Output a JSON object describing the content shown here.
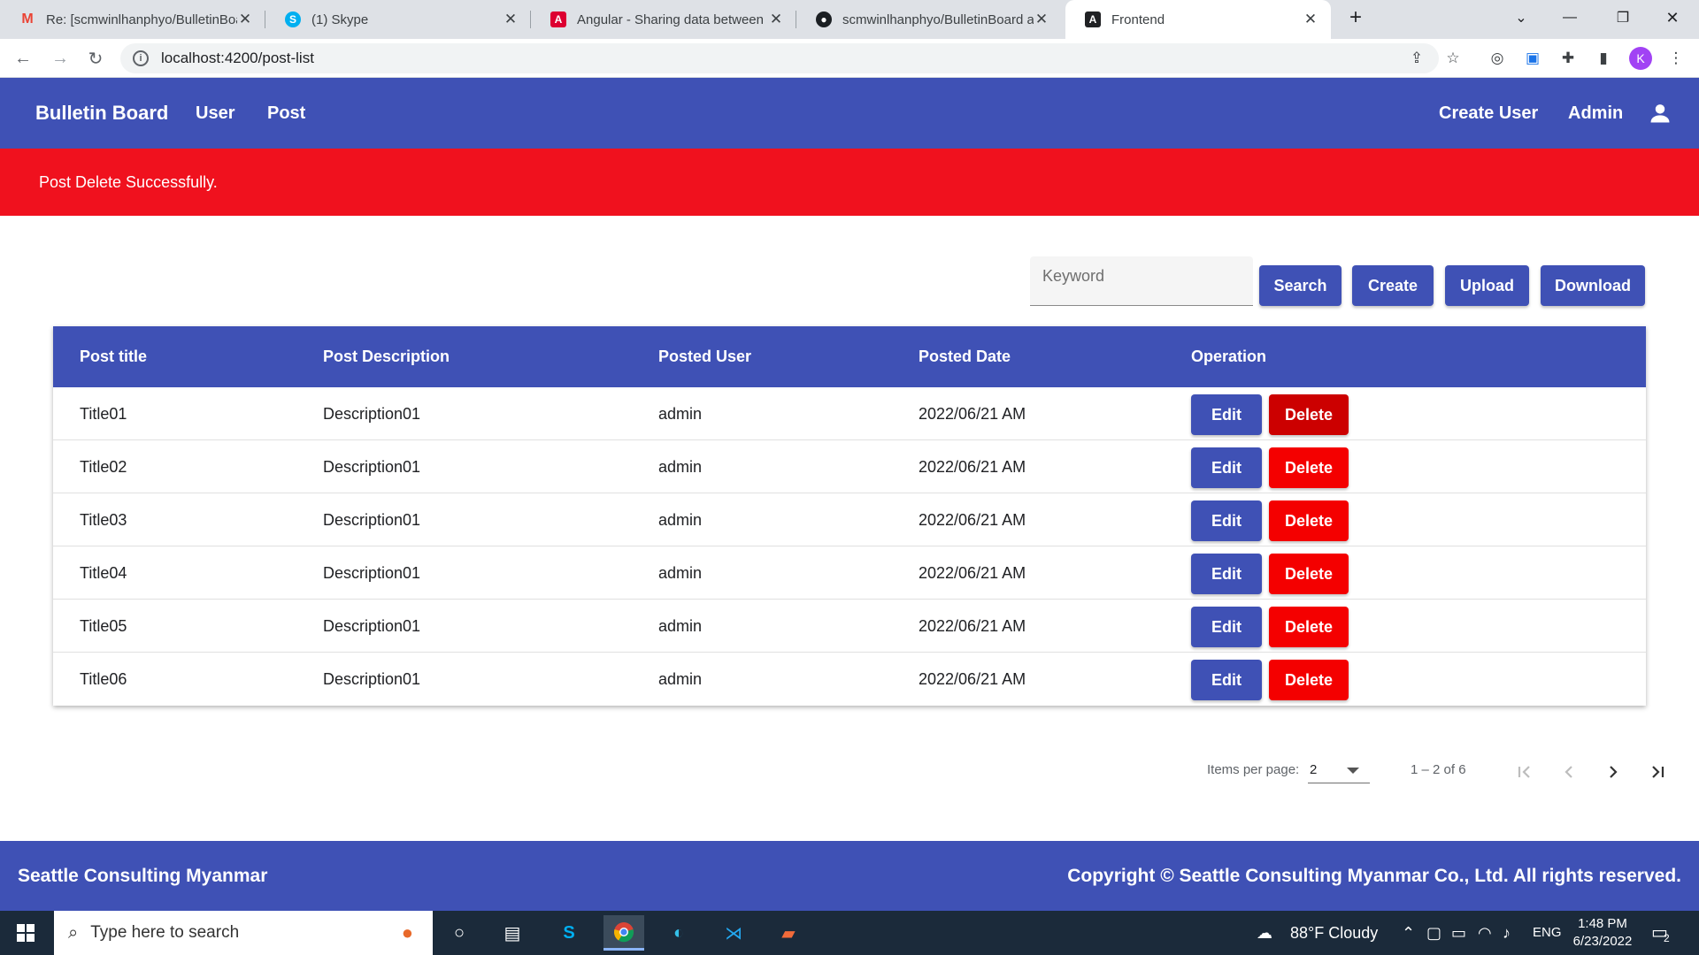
{
  "browser": {
    "tabs": [
      {
        "title": "Re: [scmwinlhanphyo/BulletinBoa",
        "icon": "gmail-icon",
        "color": "#ea4335"
      },
      {
        "title": "(1) Skype",
        "icon": "skype-icon",
        "color": "#00aff0"
      },
      {
        "title": "Angular - Sharing data between",
        "icon": "angular-icon",
        "color": "#dd0031"
      },
      {
        "title": "scmwinlhanphyo/BulletinBoard a",
        "icon": "github-icon",
        "color": "#1b1f23"
      },
      {
        "title": "Frontend",
        "icon": "angular-icon",
        "color": "#202124"
      }
    ],
    "new_tab": "+",
    "url": "localhost:4200/post-list",
    "profile_initial": "K"
  },
  "header": {
    "brand": "Bulletin Board",
    "nav": [
      "User",
      "Post"
    ],
    "create_user": "Create User",
    "admin": "Admin"
  },
  "alert": {
    "message": "Post Delete Successfully."
  },
  "toolbar": {
    "keyword_placeholder": "Keyword",
    "search": "Search",
    "create": "Create",
    "upload": "Upload",
    "download": "Download"
  },
  "table": {
    "columns": [
      "Post title",
      "Post Description",
      "Posted User",
      "Posted Date",
      "Operation"
    ],
    "rows": [
      {
        "title": "Title01",
        "description": "Description01",
        "user": "admin",
        "date": "2022/06/21 AM"
      },
      {
        "title": "Title02",
        "description": "Description01",
        "user": "admin",
        "date": "2022/06/21 AM"
      },
      {
        "title": "Title03",
        "description": "Description01",
        "user": "admin",
        "date": "2022/06/21 AM"
      },
      {
        "title": "Title04",
        "description": "Description01",
        "user": "admin",
        "date": "2022/06/21 AM"
      },
      {
        "title": "Title05",
        "description": "Description01",
        "user": "admin",
        "date": "2022/06/21 AM"
      },
      {
        "title": "Title06",
        "description": "Description01",
        "user": "admin",
        "date": "2022/06/21 AM"
      }
    ],
    "edit": "Edit",
    "delete": "Delete"
  },
  "paginator": {
    "label": "Items per page:",
    "page_size": "2",
    "range": "1 – 2 of 6"
  },
  "footer": {
    "left": "Seattle Consulting Myanmar",
    "right": "Copyright © Seattle Consulting Myanmar Co., Ltd. All rights reserved."
  },
  "taskbar": {
    "search_placeholder": "Type here to search",
    "weather": "88°F  Cloudy",
    "language": "ENG",
    "time": "1:48 PM",
    "date": "6/23/2022",
    "notifications": "2"
  },
  "colors": {
    "primary": "#3f51b5",
    "danger": "#f40000",
    "alert": "#f0111e"
  }
}
